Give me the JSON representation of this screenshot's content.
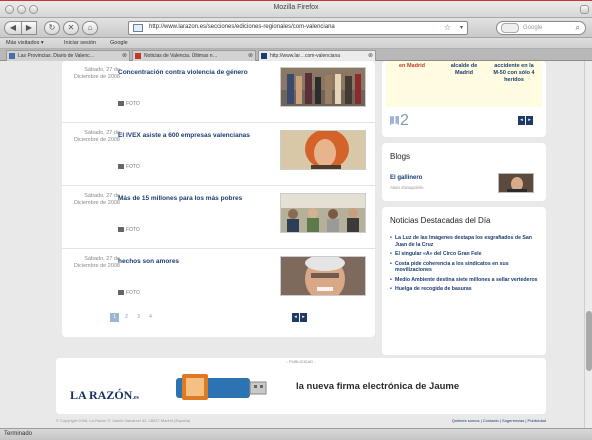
{
  "window": {
    "title": "Mozilla Firefox",
    "url": "http://www.larazon.es/secciones/ediciones-regionales/com-valenciana",
    "search_placeholder": "Google",
    "status": "Terminado"
  },
  "bookmarks": [
    "Más visitados ▾",
    "Iniciar sesión",
    "Google"
  ],
  "tabs": [
    {
      "label": "Las Provincias. Diario de Valenc…"
    },
    {
      "label": "Noticias de Valencia. Últimas n…"
    },
    {
      "label": "http://www.lar…com-valenciana"
    }
  ],
  "articles": [
    {
      "date": "Sábado, 27 de Diciembre de 2008",
      "title": "Concentración contra violencia de género",
      "foto": "FOTO"
    },
    {
      "date": "Sábado, 27 de Diciembre de 2008",
      "title": "El IVEX asiste a 600 empresas valencianas",
      "foto": "FOTO"
    },
    {
      "date": "Sábado, 27 de Diciembre de 2008",
      "title": "Más de 15 millones para los más pobres",
      "foto": "FOTO"
    },
    {
      "date": "Sábado, 27 de Diciembre de 2008",
      "title": "hechos son amores",
      "foto": "FOTO"
    }
  ],
  "pager": {
    "pages": [
      "1",
      "2",
      "3",
      "4"
    ],
    "current": "1"
  },
  "side_top": {
    "items": [
      "en Madrid",
      "alcalde de Madrid",
      "accidente en la M-50 con sólo 4 heridos"
    ],
    "pages": [
      "1",
      "2"
    ]
  },
  "blogs": {
    "title": "Blogs",
    "name": "El gallinero",
    "author": "Alain Zanapolelo"
  },
  "destacadas": {
    "title": "Noticias Destacadas del Día",
    "items": [
      "La Luz de las Imágenes destapa los esgrafiados de San Juan de la Cruz",
      "El singular «A» del Circo Gran Fele",
      "Costa pide coherencia a los sindicatos en sus movilizaciones",
      "Medio Ambiente destina siete millones a sellar vertederos",
      "Huelga de recogida de basuras"
    ]
  },
  "ad": {
    "label": "- PUBLICIDAD -",
    "logo": "LA RAZÓN",
    "logo_suffix": ".es",
    "text": "la nueva firma electrónica de Jaume"
  },
  "footer": {
    "left": "© Copyright 2008, La Razón © Josefa Valcárcel 42, 28027 Madrid (España)",
    "right": "Quiénes somos | Contacto | Sugerencias | Publicidad"
  }
}
